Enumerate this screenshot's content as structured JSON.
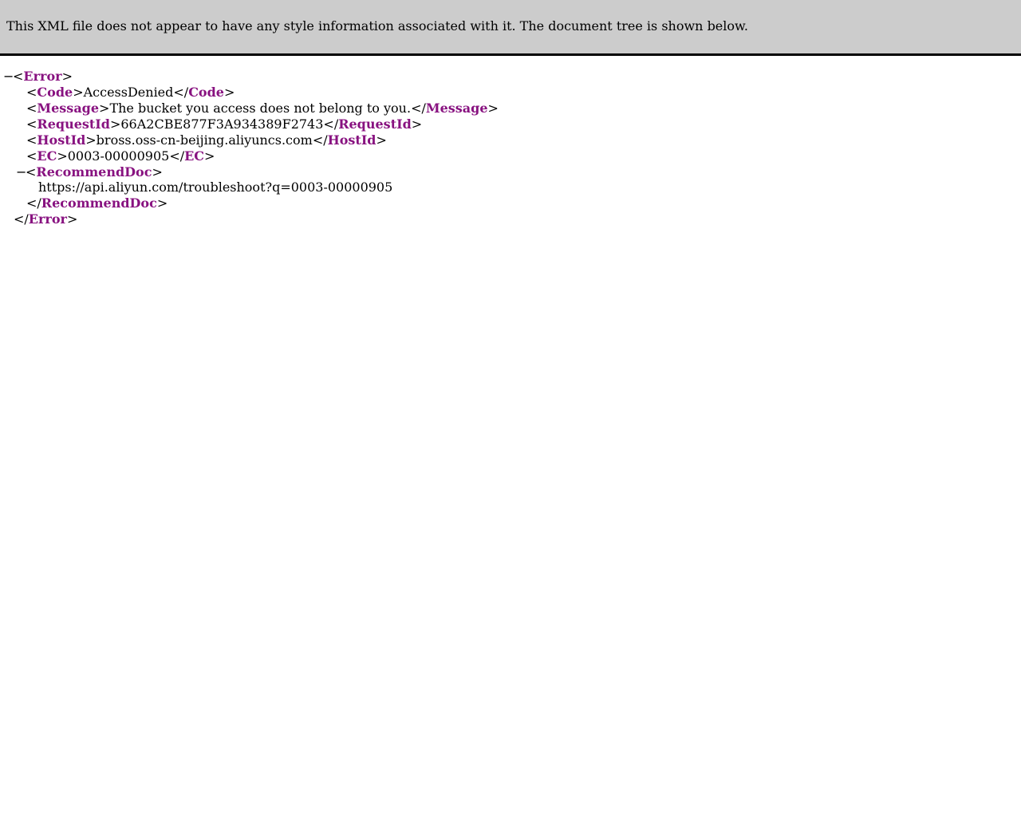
{
  "banner": {
    "message": "This XML file does not appear to have any style information associated with it. The document tree is shown below."
  },
  "xml": {
    "collapse_glyph": "−",
    "root": {
      "tag": "Error",
      "children": {
        "code": {
          "tag": "Code",
          "value": "AccessDenied"
        },
        "message": {
          "tag": "Message",
          "value": "The bucket you access does not belong to you."
        },
        "request_id": {
          "tag": "RequestId",
          "value": "66A2CBE877F3A934389F2743"
        },
        "host_id": {
          "tag": "HostId",
          "value": "bross.oss-cn-beijing.aliyuncs.com"
        },
        "ec": {
          "tag": "EC",
          "value": "0003-00000905"
        },
        "recommend_doc": {
          "tag": "RecommendDoc",
          "value": "https://api.aliyun.com/troubleshoot?q=0003-00000905"
        }
      }
    }
  },
  "colors": {
    "tag_name": "#881280",
    "banner_background": "#cccccc"
  }
}
